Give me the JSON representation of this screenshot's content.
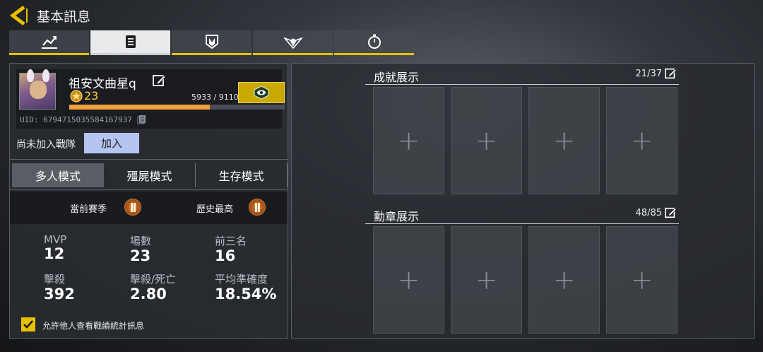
{
  "header": {
    "back_icon": "back-arrow-icon",
    "title": "基本訊息"
  },
  "tabs": [
    {
      "icon": "stats-chart-icon",
      "active": false
    },
    {
      "icon": "clipboard-icon",
      "active": true
    },
    {
      "icon": "emblem-shield-icon",
      "active": false
    },
    {
      "icon": "winged-badge-icon",
      "active": false
    },
    {
      "icon": "stopwatch-icon",
      "active": false
    }
  ],
  "profile": {
    "name": "祖安文曲星q",
    "level": "23",
    "xp_text": "5933 / 9110",
    "xp_progress": 0.651,
    "uid": "UID: 6794715035584167937",
    "accent": "#e6c100"
  },
  "clan": {
    "status": "尚未加入戰隊",
    "join_label": "加入"
  },
  "modes": [
    {
      "label": "多人模式",
      "active": true
    },
    {
      "label": "殭屍模式",
      "active": false
    },
    {
      "label": "生存模式",
      "active": false
    }
  ],
  "season": {
    "current_label": "當前賽季",
    "history_label": "歷史最高"
  },
  "stats": [
    {
      "label": "MVP",
      "value": "12"
    },
    {
      "label": "場數",
      "value": "23"
    },
    {
      "label": "前三名",
      "value": "16"
    },
    {
      "label": "擊殺",
      "value": "392"
    },
    {
      "label": "擊殺/死亡",
      "value": "2.80"
    },
    {
      "label": "平均準確度",
      "value": "18.54%"
    }
  ],
  "allow_stats": {
    "checked": true,
    "label": "允許他人查看戰績統計訊息"
  },
  "achievements": {
    "title": "成就展示",
    "count": "21/37",
    "slots": 4
  },
  "medals": {
    "title": "勳章展示",
    "count": "48/85",
    "slots": 4
  }
}
